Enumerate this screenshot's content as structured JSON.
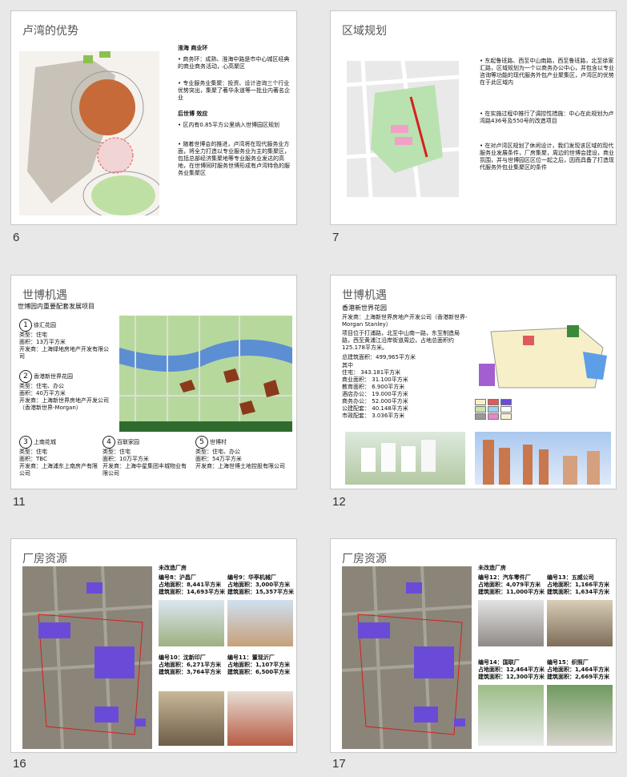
{
  "slides": [
    {
      "num": "6",
      "title": "卢湾的优势",
      "h1": "淮海 商业环",
      "b1": "商务环：成熟、淮海中路是市中心城区经典的商业商务活动，心高聚区",
      "b2": "专业服务业集聚：投资、设计咨询三个行业优势突出，集聚了著华永道等一批业内著名企业",
      "h2": "后世博 效应",
      "b3": "区内有0.85平方公里纳入世博园区规划",
      "b4": "随着世博会的推进，卢湾将在现代服务业方面，将全力打造以专业服务业为主的集聚区，包括总部经济集聚地等专业服务业发达的高地，在世博同时服务世博形成有卢湾特色的服务业集聚区"
    },
    {
      "num": "7",
      "title": "区域规划",
      "b1": "东起鲁班路、西至中山南路，西至鲁班路，北至徐家汇路，区域规划为一个以商务办公中心，并包含以专业咨询等功能的现代服务外包产业聚集区，卢湾区的优势在于此区域内",
      "b2": "在实施过程中推行了调控性措施：中心在此规划为卢湾路436号及550号的改造项目",
      "b3": "在对卢湾区规划了休闲设计，我们发现该区域的现代服务业发展条件，厂房集聚，周边的世博会建设，商业氛围，并与世博园区区位一起之后，因而具备了打造现代服务外包业集聚区的条件"
    },
    {
      "num": "11",
      "title": "世博机遇",
      "sub": "世博园内重要配套发展项目",
      "projects": [
        {
          "n": "1",
          "name": "徐汇花园",
          "type": "类型：住宅",
          "area": "面积：13万平方米",
          "dev": "开发商：上海绿地房地产开发有限公司"
        },
        {
          "n": "2",
          "name": "香港新世界花园",
          "type": "类型：住宅、办公",
          "area": "面积：40万平方米",
          "dev": "开发商：上海新世界房地产开发公司（香港新世界-Morgan）"
        },
        {
          "n": "3",
          "name": "上南花城",
          "type": "类型：住宅",
          "area": "面积：TBC",
          "dev": "开发商：上海浦东上南房产有限公司"
        },
        {
          "n": "4",
          "name": "百联家园",
          "type": "类型：住宅",
          "area": "面积：10万平方米",
          "dev": "开发商：上海中星集团丰城物业有限公司"
        },
        {
          "n": "5",
          "name": "世博村",
          "type": "类型：住宅、办公",
          "area": "面积：54万平方米",
          "dev": "开发商：上海世博土地控股有限公司"
        }
      ]
    },
    {
      "num": "12",
      "title": "世博机遇",
      "sub": "香港新世界花园",
      "dev": "开发商：上海新世界房地产开发公司（香港新世界-Morgan Stanley）",
      "desc": "项目位于打浦路，北至中山南一路，东至制造局路，西至黄浦江沿岸街道周边，占地总面积约125.178平方米。",
      "gfa": "总建筑面积：499,965平方米",
      "stats": [
        {
          "k": "其中",
          "v": ""
        },
        {
          "k": "住宅：",
          "v": "343.181平方米"
        },
        {
          "k": "商业面积：",
          "v": "31.100平方米"
        },
        {
          "k": "教育面积：",
          "v": "6.900平方米"
        },
        {
          "k": "酒店办公：",
          "v": "19.000平方米"
        },
        {
          "k": "商务办公：",
          "v": "52.000平方米"
        },
        {
          "k": "公建配套：",
          "v": "40.148平方米"
        },
        {
          "k": "市政配套：",
          "v": "3.036平方米"
        }
      ]
    },
    {
      "num": "16",
      "title": "厂房资源",
      "sub": "未改造厂房",
      "items": [
        {
          "code": "编号8：",
          "name": "沪昌厂",
          "area1": "占地面积：8,441平方米",
          "area2": "建筑面积：14,693平方米"
        },
        {
          "code": "编号9：",
          "name": "华亭机械厂",
          "area1": "占地面积：3,000平方米",
          "area2": "建筑面积：15,357平方米"
        },
        {
          "code": "编号10：",
          "name": "沈新印厂",
          "area1": "占地面积：6,271平方米",
          "area2": "建筑面积：3,764平方米"
        },
        {
          "code": "编号11：",
          "name": "董现沂厂",
          "area1": "占地面积：1,107平方米",
          "area2": "建筑面积：6,500平方米"
        }
      ]
    },
    {
      "num": "17",
      "title": "厂房资源",
      "sub": "未改造厂房",
      "items": [
        {
          "code": "编号12：",
          "name": "汽车零件厂",
          "area1": "占地面积：4,079平方米",
          "area2": "建筑面积：11,000平方米"
        },
        {
          "code": "编号13：",
          "name": "五威公司",
          "area1": "占地面积：1,166平方米",
          "area2": "建筑面积：1,634平方米"
        },
        {
          "code": "编号14：",
          "name": "国联厂",
          "area1": "占地面积：12,464平方米",
          "area2": "建筑面积：12,300平方米"
        },
        {
          "code": "编号15：",
          "name": "织照厂",
          "area1": "占地面积：1,464平方米",
          "area2": "建筑面积：2,669平方米"
        }
      ]
    }
  ],
  "colors": {
    "accent": "#6a4bd8",
    "red": "#d81e1e"
  }
}
